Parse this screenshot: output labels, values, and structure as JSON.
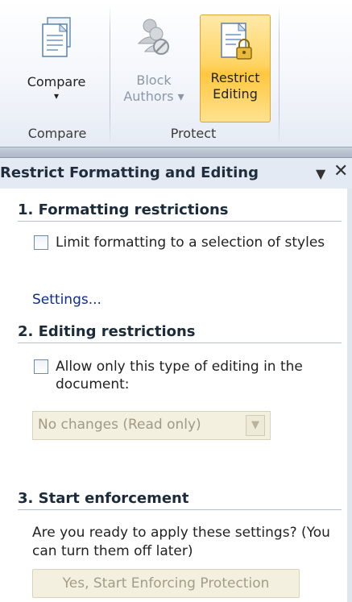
{
  "ribbon": {
    "compare_button": {
      "label_line1": "Compare",
      "label_line2": "▾",
      "icon": "document-compare-icon"
    },
    "block_authors_button": {
      "label_line1": "Block",
      "label_line2": "Authors ▾",
      "icon": "block-authors-icon"
    },
    "restrict_editing_button": {
      "label_line1": "Restrict",
      "label_line2": "Editing",
      "icon": "document-lock-icon"
    },
    "groups": [
      {
        "label": "Compare"
      },
      {
        "label": "Protect"
      }
    ]
  },
  "pane": {
    "title": "Restrict Formatting and Editing",
    "menu_glyph": "▼",
    "close_glyph": "✕",
    "section1": {
      "heading": "1. Formatting restrictions",
      "checkbox_label": "Limit formatting to a selection of styles",
      "checked": false,
      "settings_link": "Settings..."
    },
    "section2": {
      "heading": "2. Editing restrictions",
      "checkbox_label": "Allow only this type of editing in the document:",
      "checked": false,
      "dropdown_value": "No changes (Read only)"
    },
    "section3": {
      "heading": "3. Start enforcement",
      "prompt": "Are you ready to apply these settings? (You can turn them off later)",
      "button_label": "Yes, Start Enforcing Protection"
    }
  }
}
